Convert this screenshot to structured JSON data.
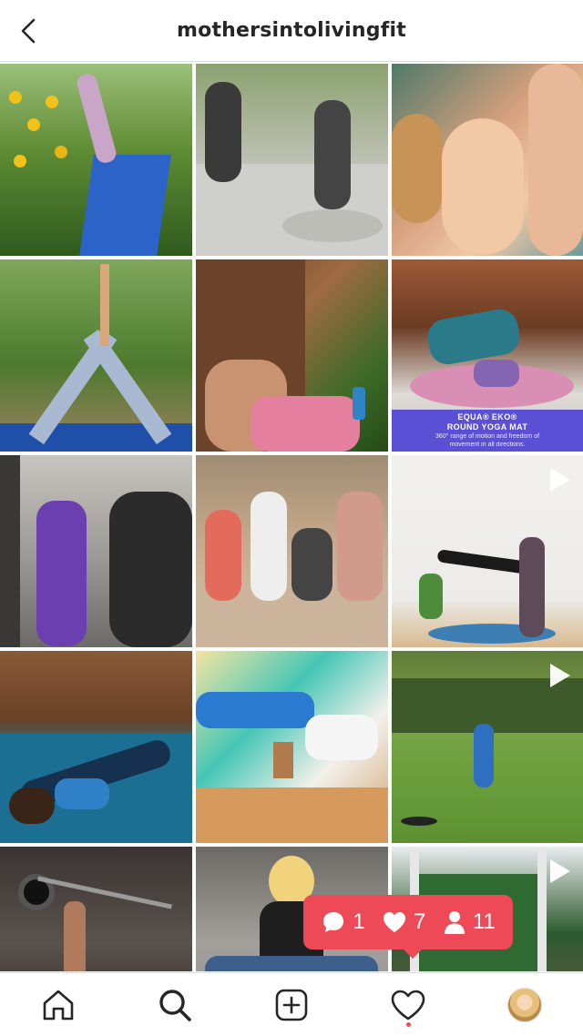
{
  "header": {
    "title": "mothersintolivingfit",
    "back_icon": "chevron-left-icon"
  },
  "grid": {
    "tiles": [
      {
        "name": "sunflower-field-yoga",
        "video": false
      },
      {
        "name": "mother-son-meditation",
        "video": false
      },
      {
        "name": "selfie-with-dog",
        "video": false
      },
      {
        "name": "triangle-pose-garden",
        "video": false
      },
      {
        "name": "woman-with-spray-bottle",
        "video": false
      },
      {
        "name": "round-yoga-mat-promo",
        "video": false
      },
      {
        "name": "gym-mirror-selfie",
        "video": false
      },
      {
        "name": "family-group-photo",
        "video": false
      },
      {
        "name": "assisted-headstand",
        "video": true
      },
      {
        "name": "reclined-leg-stretch",
        "video": false
      },
      {
        "name": "bridge-pose-mandala",
        "video": false
      },
      {
        "name": "boy-running-lawn",
        "video": true
      },
      {
        "name": "bench-press-workout",
        "video": false
      },
      {
        "name": "child-meditation",
        "video": false
      },
      {
        "name": "indoor-yoga-window",
        "video": true
      }
    ],
    "promo": {
      "title_line1": "EQUA® EKO®",
      "title_line2": "ROUND YOGA MAT",
      "subtitle_line1": "360° range of motion and freedom of",
      "subtitle_line2": "movement in all directions."
    }
  },
  "activity": {
    "comments": "1",
    "likes": "7",
    "followers": "11",
    "color": "#ed4956"
  },
  "tabbar": {
    "items": [
      "home-icon",
      "search-icon",
      "new-post-icon",
      "activity-heart-icon",
      "profile-avatar"
    ]
  }
}
